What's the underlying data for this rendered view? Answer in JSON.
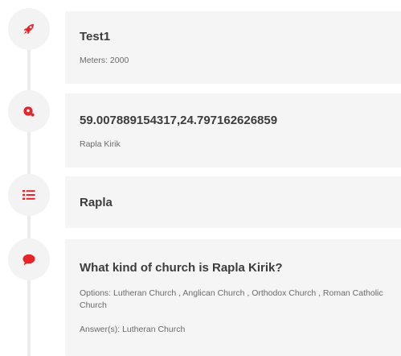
{
  "colors": {
    "accent": "#e8242b",
    "card_bg": "#f5f5f5",
    "node_bg": "#f3f3f3",
    "spine": "#ececec",
    "title_text": "#3c3c3c",
    "body_text": "#6b6b6b"
  },
  "entries": [
    {
      "icon": "rocket-icon",
      "title": "Test1",
      "lines": [
        "Meters: 2000"
      ]
    },
    {
      "icon": "location-pin-icon",
      "title": "59.007889154317,24.797162626859",
      "lines": [
        "Rapla Kirik"
      ]
    },
    {
      "icon": "list-icon",
      "title": "Rapla",
      "lines": []
    },
    {
      "icon": "chat-bubble-icon",
      "title": "What kind of church is Rapla Kirik?",
      "options": "Options: Lutheran Church , Anglican Church , Orthodox Church , Roman Catholic Church",
      "answer": "Answer(s): Lutheran Church"
    }
  ]
}
